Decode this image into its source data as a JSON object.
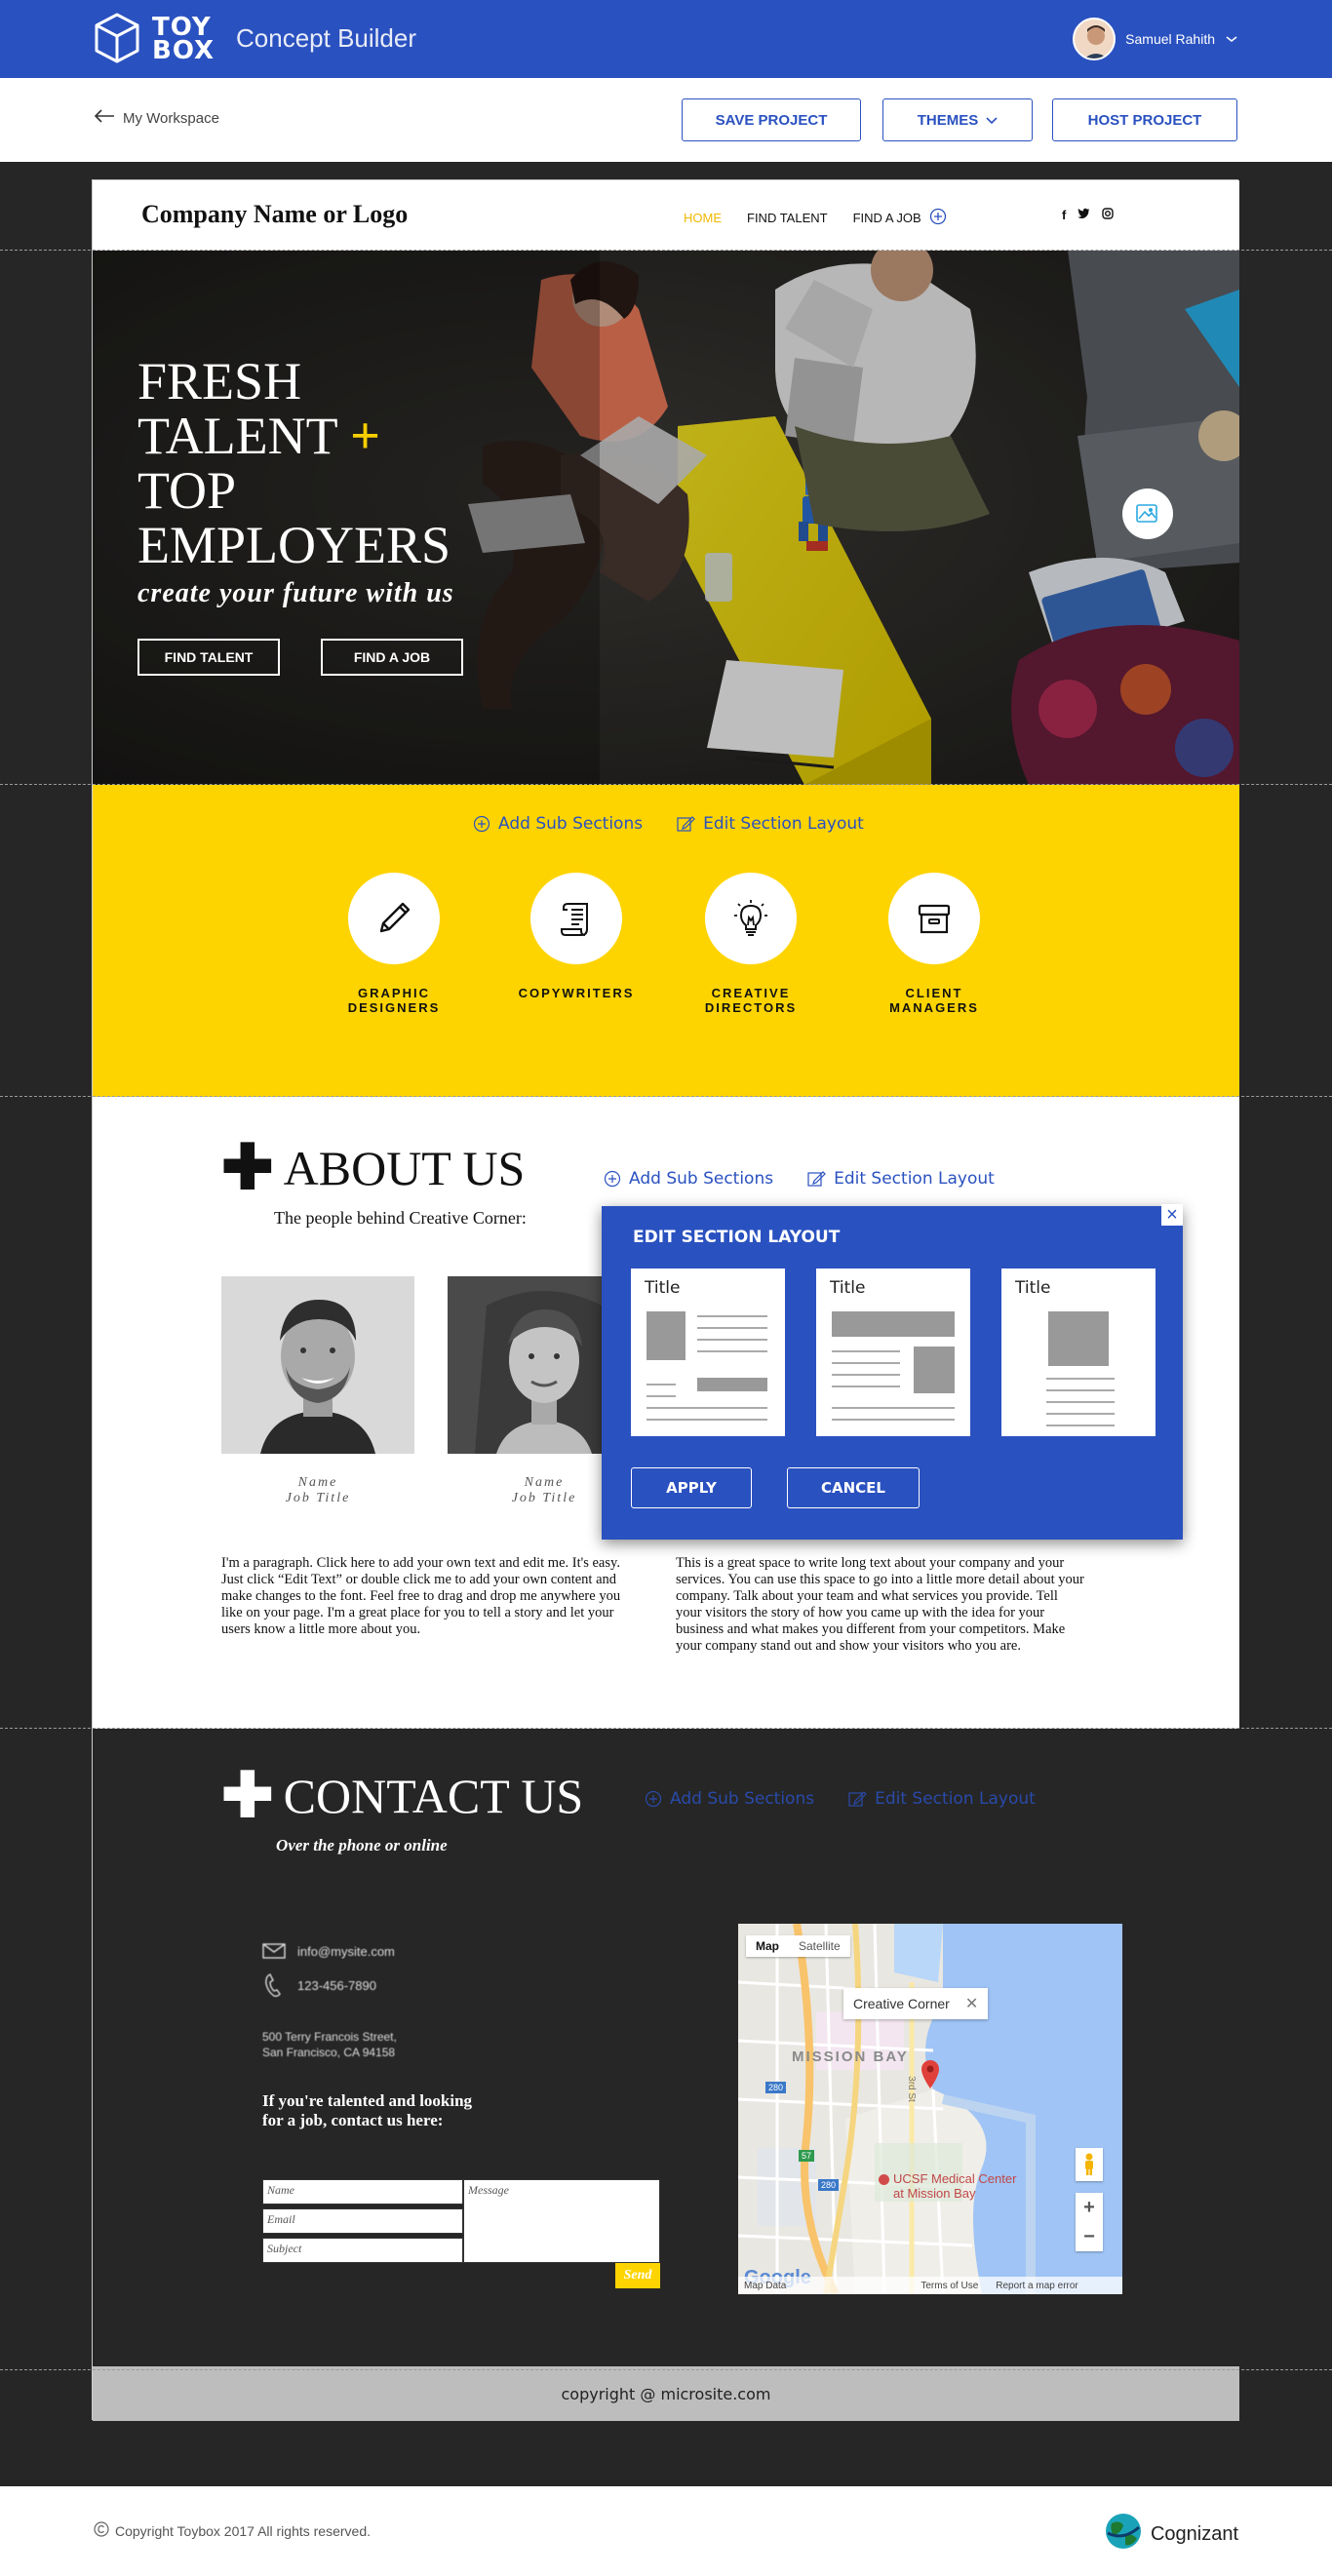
{
  "app": {
    "logo_line1": "TOY",
    "logo_line2": "BOX",
    "name": "Concept Builder",
    "user_name": "Samuel Rahith"
  },
  "toolbar": {
    "back_label": "My Workspace",
    "save_label": "SAVE PROJECT",
    "themes_label": "THEMES",
    "host_label": "HOST PROJECT"
  },
  "site": {
    "brand": "Company Name or Logo",
    "nav": [
      "HOME",
      "FIND TALENT",
      "FIND A JOB"
    ],
    "social": [
      "f",
      "t",
      "ig"
    ]
  },
  "hero": {
    "line1": "FRESH",
    "line2": "TALENT",
    "plus": "+",
    "line3": "TOP",
    "line4": "EMPLOYERS",
    "subtitle": "create your future with us",
    "btn_talent": "FIND TALENT",
    "btn_job": "FIND A JOB"
  },
  "section_controls": {
    "add_sub": "Add Sub Sections",
    "edit_layout": "Edit Section Layout"
  },
  "categories": [
    {
      "line1": "GRAPHIC",
      "line2": "DESIGNERS",
      "icon": "pencil-icon"
    },
    {
      "line1": "COPYWRITERS",
      "line2": "",
      "icon": "scroll-icon"
    },
    {
      "line1": "CREATIVE",
      "line2": "DIRECTORS",
      "icon": "lightbulb-icon"
    },
    {
      "line1": "CLIENT",
      "line2": "MANAGERS",
      "icon": "archive-box-icon"
    }
  ],
  "about": {
    "title": "ABOUT US",
    "subtitle": "The people behind Creative Corner:",
    "people": [
      {
        "name": "Name",
        "title": "Job Title"
      },
      {
        "name": "Name",
        "title": "Job Title"
      }
    ],
    "para1": "I'm a paragraph. Click here to add your own text and edit me. It's easy. Just click “Edit Text” or double click me to add your own content and make changes to the font. Feel free to drag and drop me anywhere you like on your page. I'm a great place for you to tell a story and let your users know a little more about you.",
    "para2": "This is a great space to write long text about your company and your services. You can use this space to go into a little more detail about your company. Talk about your team and what services you provide. Tell your visitors the story of how you came up with the idea for your business and what makes you different from your competitors. Make your company stand out and show your visitors who you are."
  },
  "modal": {
    "title": "EDIT SECTION LAYOUT",
    "close": "×",
    "layouts": [
      "Title",
      "Title",
      "Title"
    ],
    "apply": "APPLY",
    "cancel": "CANCEL"
  },
  "contact": {
    "title": "CONTACT US",
    "subtitle": "Over the phone or online",
    "email": "info@mysite.com",
    "phone": "123-456-7890",
    "address1": "500 Terry Francois Street,",
    "address2": "San Francisco, CA 94158",
    "cta1": "If you're talented and looking",
    "cta2": "for a job, contact us here:",
    "ph_name": "Name",
    "ph_email": "Email",
    "ph_subject": "Subject",
    "ph_message": "Message",
    "send": "Send"
  },
  "map": {
    "tab_map": "Map",
    "tab_satellite": "Satellite",
    "popup": "Creative Corner",
    "district": "MISSION BAY",
    "poi1": "UCSF Medical Center",
    "poi2": "at Mission Bay",
    "street": "3rd St",
    "google": "Google",
    "map_data": "Map Data",
    "terms": "Terms of Use",
    "report": "Report a map error",
    "zoom_in": "+",
    "zoom_out": "−",
    "hw1": "280",
    "hw2": "280",
    "hw3": "57"
  },
  "footer": {
    "copy": "copyright @ microsite.com",
    "bottom_copy": "Copyright Toybox 2017 All rights reserved.",
    "cognizant": "Cognizant"
  },
  "colors": {
    "primary": "#2a51c0",
    "accent_yellow": "#fed400",
    "dark": "#262626"
  }
}
